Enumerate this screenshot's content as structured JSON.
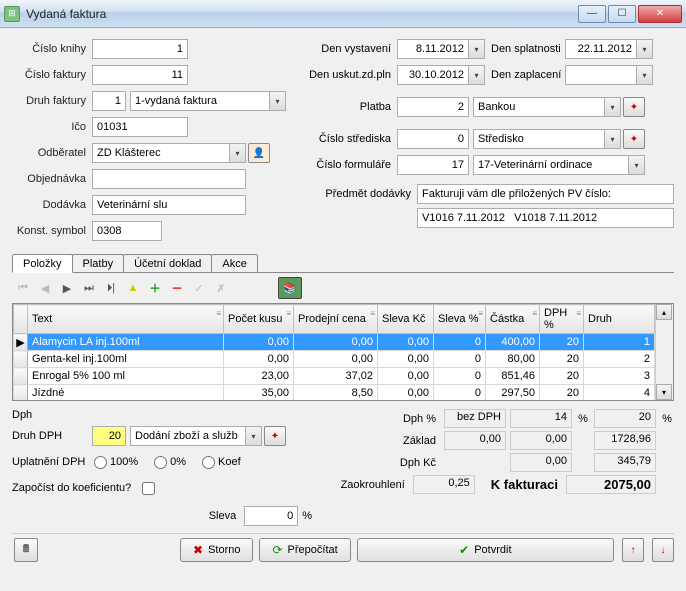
{
  "window": {
    "title": "Vydaná faktura"
  },
  "left": {
    "cislo_knihy_lbl": "Číslo knihy",
    "cislo_knihy": "1",
    "cislo_faktury_lbl": "Číslo faktury",
    "cislo_faktury": "11",
    "druh_faktury_lbl": "Druh faktury",
    "druh_faktury_num": "1",
    "druh_faktury_txt": "1-vydaná faktura",
    "ico_lbl": "Ičo",
    "ico": "01031",
    "odberatel_lbl": "Odběratel",
    "odberatel": "ZD Klášterec",
    "objednavka_lbl": "Objednávka",
    "objednavka": "",
    "dodavka_lbl": "Dodávka",
    "dodavka": "Veterinární slu",
    "konst_lbl": "Konst. symbol",
    "konst": "0308"
  },
  "right": {
    "den_vystaveni_lbl": "Den vystavení",
    "den_vystaveni": "8.11.2012",
    "den_splatnosti_lbl": "Den splatnosti",
    "den_splatnosti": "22.11.2012",
    "den_uskut_lbl": "Den uskut.zd.pln",
    "den_uskut": "30.10.2012",
    "den_zaplaceni_lbl": "Den zaplacení",
    "den_zaplaceni": "",
    "platba_lbl": "Platba",
    "platba_num": "2",
    "platba_txt": "Bankou",
    "stredisko_lbl": "Číslo střediska",
    "stredisko_num": "0",
    "stredisko_txt": "Středisko",
    "formular_lbl": "Číslo formuláře",
    "formular_num": "17",
    "formular_txt": "17-Veterinární ordinace",
    "predmet_lbl": "Předmět dodávky",
    "predmet": "Fakturuji vám dle přiložených PV číslo:",
    "predmet2": "V1016 7.11.2012   V1018 7.11.2012"
  },
  "tabs": {
    "polozky": "Položky",
    "platby": "Platby",
    "ucetni": "Účetní doklad",
    "akce": "Akce"
  },
  "grid": {
    "cols": {
      "text": "Text",
      "kusu": "Počet kusu",
      "cena": "Prodejní cena",
      "sleva_kc": "Sleva Kč",
      "sleva_pct": "Sleva %",
      "castka": "Částka",
      "dph_pct": "DPH %",
      "druh": "Druh"
    },
    "rows": [
      {
        "text": "Alamycin LA inj.100ml",
        "kusu": "0,00",
        "cena": "0,00",
        "sleva_kc": "0,00",
        "sleva_pct": "0",
        "castka": "400,00",
        "dph": "20",
        "druh": "1"
      },
      {
        "text": "Genta-kel inj.100ml",
        "kusu": "0,00",
        "cena": "0,00",
        "sleva_kc": "0,00",
        "sleva_pct": "0",
        "castka": "80,00",
        "dph": "20",
        "druh": "2"
      },
      {
        "text": "Enrogal 5% 100 ml",
        "kusu": "23,00",
        "cena": "37,02",
        "sleva_kc": "0,00",
        "sleva_pct": "0",
        "castka": "851,46",
        "dph": "20",
        "druh": "3"
      },
      {
        "text": "Jízdné",
        "kusu": "35,00",
        "cena": "8,50",
        "sleva_kc": "0,00",
        "sleva_pct": "0",
        "castka": "297,50",
        "dph": "20",
        "druh": "4"
      }
    ]
  },
  "dph": {
    "title": "Dph",
    "druh_lbl": "Druh DPH",
    "druh_val": "20",
    "druh_txt": "Dodání zboží a služb",
    "uplatneni_lbl": "Uplatnění DPH",
    "r100": "100%",
    "r0": "0%",
    "rkoef": "Koef",
    "zapocist_lbl": "Započíst do koeficientu?",
    "sleva_lbl": "Sleva",
    "sleva_val": "0",
    "sleva_pct": "%"
  },
  "totals": {
    "dph_pct_lbl": "Dph %",
    "bez_dph": "bez DPH",
    "v14": "14",
    "v20": "20",
    "zaklad_lbl": "Základ",
    "zaklad0": "0,00",
    "zaklad14": "0,00",
    "zaklad20": "1728,96",
    "dphkc_lbl": "Dph Kč",
    "dphkc14": "0,00",
    "dphkc20": "345,79",
    "zaokr_lbl": "Zaokrouhlení",
    "zaokr": "0,25",
    "kfakt_lbl": "K fakturaci",
    "kfakt": "2075,00",
    "pct": "%"
  },
  "footer": {
    "storno": "Storno",
    "prepocitat": "Přepočítat",
    "potvrdit": "Potvrdit"
  }
}
